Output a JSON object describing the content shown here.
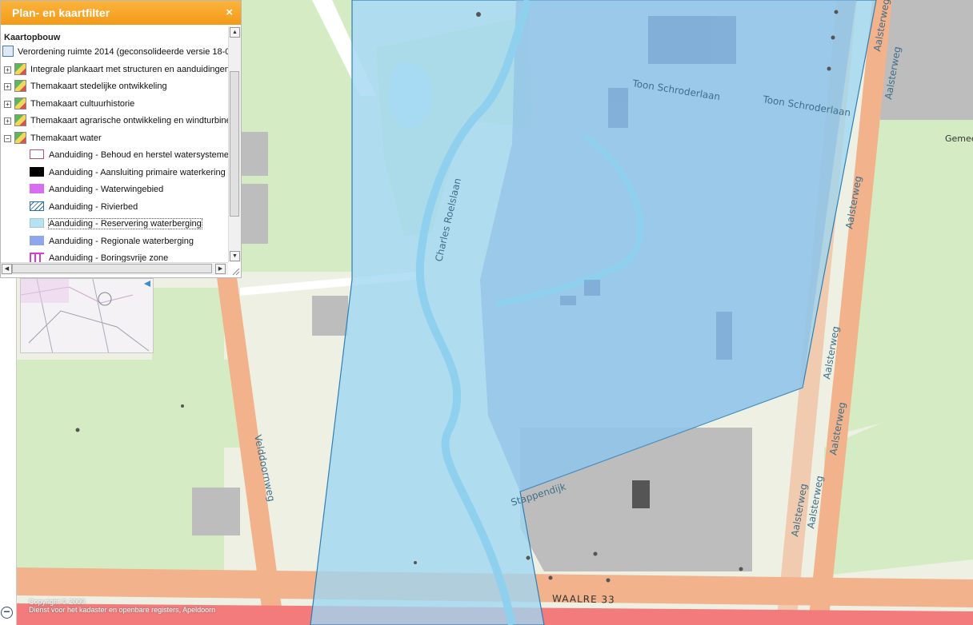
{
  "panel": {
    "title": "Plan- en kaartfilter",
    "close_symbol": "×",
    "section_title": "Kaartopbouw",
    "root_layer": "Verordening ruimte 2014 (geconsolideerde versie 18-0",
    "themes": [
      {
        "label": "Integrale plankaart met structuren en aanduidingen",
        "expander": "+"
      },
      {
        "label": "Themakaart stedelijke ontwikkeling",
        "expander": "+"
      },
      {
        "label": "Themakaart cultuurhistorie",
        "expander": "+"
      },
      {
        "label": "Themakaart agrarische ontwikkeling en windturbine",
        "expander": "+"
      },
      {
        "label": "Themakaart water",
        "expander": "−"
      }
    ],
    "legend_items": [
      {
        "label": "Aanduiding - Behoud en herstel watersysteme",
        "swatch": "outline-red"
      },
      {
        "label": "Aanduiding - Aansluiting primaire waterkering",
        "swatch": "black"
      },
      {
        "label": "Aanduiding - Waterwingebied",
        "swatch": "violet"
      },
      {
        "label": "Aanduiding - Rivierbed",
        "swatch": "hatched-blue"
      },
      {
        "label": "Aanduiding - Reservering waterberging",
        "swatch": "light-blue"
      },
      {
        "label": "Aanduiding - Regionale waterberging",
        "swatch": "medium-blue"
      },
      {
        "label": "Aanduiding - Boringsvrije zone",
        "swatch": "magenta-bars"
      }
    ],
    "colors": {
      "header": "#f5a623",
      "outline_red": "#c0506a",
      "violet": "#d76ef0",
      "light_blue": "#b8e2f4",
      "medium_blue": "#8ea7ec",
      "magenta": "#d13fcf",
      "hatch_blue": "#2b6fa6"
    }
  },
  "map": {
    "street_labels": [
      "Toon Schroderlaan",
      "Toon Schroderlaan",
      "Charles Roelslaan",
      "Velddoornweg",
      "Aalsterweg",
      "Aalsterweg",
      "Aalsterweg",
      "Aalsterweg",
      "Aalsterweg",
      "Aalsterweg",
      "Aalsterweg",
      "Stappendijk",
      "WAALRE 33",
      "Gemee"
    ],
    "copyright_line1": "Copyright © 2009",
    "copyright_line2": "Dienst voor het kadaster en openbare registers, Apeldoorn",
    "zoom_out_symbol": "−",
    "colors": {
      "base": "#eef0e4",
      "green": "#d7ecc4",
      "road": "#f2b08a",
      "water_overlay": "#9fd5f0",
      "regional_overlay": "#8fb7e0",
      "railway": "#f37b7b",
      "building": "#b8b8b8"
    }
  }
}
